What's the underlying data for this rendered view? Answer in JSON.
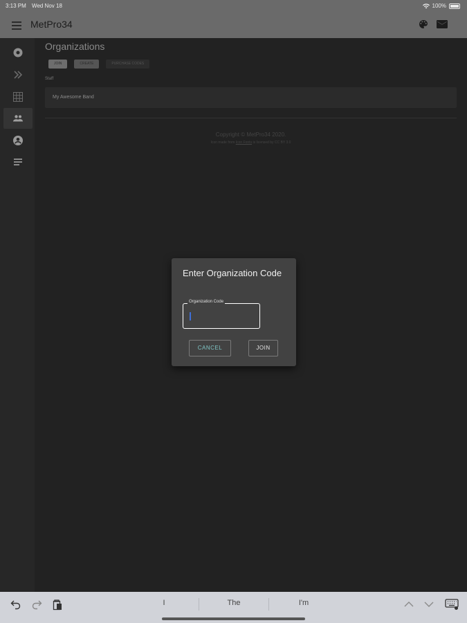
{
  "status_bar": {
    "time": "3:13 PM",
    "date": "Wed Nov 18",
    "battery": "100%",
    "icons": [
      "wifi-icon",
      "battery-icon"
    ]
  },
  "app_bar": {
    "title": "MetPro34",
    "icons": [
      "menu-icon",
      "palette-icon",
      "mail-icon"
    ]
  },
  "sidebar": {
    "items": [
      {
        "name": "dashboard",
        "icon": "circle-icon"
      },
      {
        "name": "next",
        "icon": "double-chevron-right-icon"
      },
      {
        "name": "grid",
        "icon": "grid-icon"
      },
      {
        "name": "organizations",
        "icon": "group-icon",
        "active": true
      },
      {
        "name": "profile",
        "icon": "account-icon"
      },
      {
        "name": "notes",
        "icon": "notes-icon"
      }
    ]
  },
  "main": {
    "title": "Organizations",
    "buttons": {
      "join": "JOIN",
      "create": "CREATE",
      "purchase": "PURCHASE CODES"
    },
    "section_label": "Staff",
    "org_name": "My Awesome Band",
    "copyright": "Copyright © MetPro34 2020.",
    "credits_prefix": "Icon made from",
    "credits_link": "Icon Fonts",
    "credits_suffix": "is licensed by CC BY 3.0"
  },
  "dialog": {
    "title": "Enter Organization Code",
    "field_label": "Organization Code",
    "field_value": "",
    "cancel_label": "CANCEL",
    "join_label": "JOIN"
  },
  "keyboard": {
    "suggestions": [
      "I",
      "The",
      "I'm"
    ]
  },
  "colors": {
    "app_bar": "#6a6a6a",
    "background": "#1e1e1e",
    "dialog": "#424242",
    "cancel_text": "#7fc4c4",
    "caret": "#3f6fd8"
  }
}
